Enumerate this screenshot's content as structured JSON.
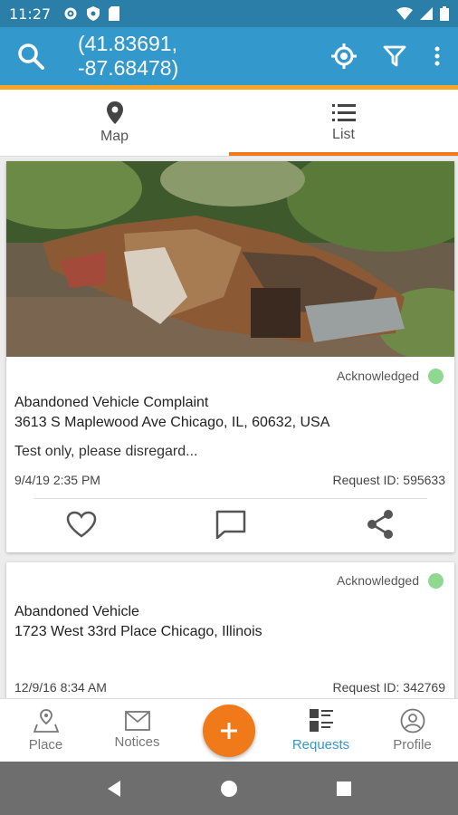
{
  "status_bar": {
    "time": "11:27"
  },
  "app_bar": {
    "coordinates_line1": "(41.83691,",
    "coordinates_line2": "-87.68478)",
    "color": "#3399cc",
    "accent": "#f5a623"
  },
  "tabs": [
    {
      "label": "Map",
      "icon": "map-pin-icon",
      "active": false
    },
    {
      "label": "List",
      "icon": "list-icon",
      "active": true
    }
  ],
  "requests": [
    {
      "status": "Acknowledged",
      "status_color": "#8fd88f",
      "title": "Abandoned Vehicle Complaint",
      "address": "3613 S Maplewood Ave Chicago, IL, 60632, USA",
      "description": "Test only, please disregard...",
      "datetime": "9/4/19 2:35 PM",
      "request_id": "Request ID: 595633",
      "has_photo": true
    },
    {
      "status": "Acknowledged",
      "status_color": "#8fd88f",
      "title": "Abandoned Vehicle",
      "address": "1723 West 33rd Place Chicago, Illinois",
      "description": "",
      "datetime": "12/9/16 8:34 AM",
      "request_id": "Request ID: 342769",
      "has_photo": false
    }
  ],
  "bottom_nav": [
    {
      "label": "Place",
      "icon": "place-icon",
      "active": false
    },
    {
      "label": "Notices",
      "icon": "mail-icon",
      "active": false
    },
    {
      "label": "Requests",
      "icon": "requests-icon",
      "active": true
    },
    {
      "label": "Profile",
      "icon": "profile-icon",
      "active": false
    }
  ],
  "fab_color": "#f07a1a"
}
